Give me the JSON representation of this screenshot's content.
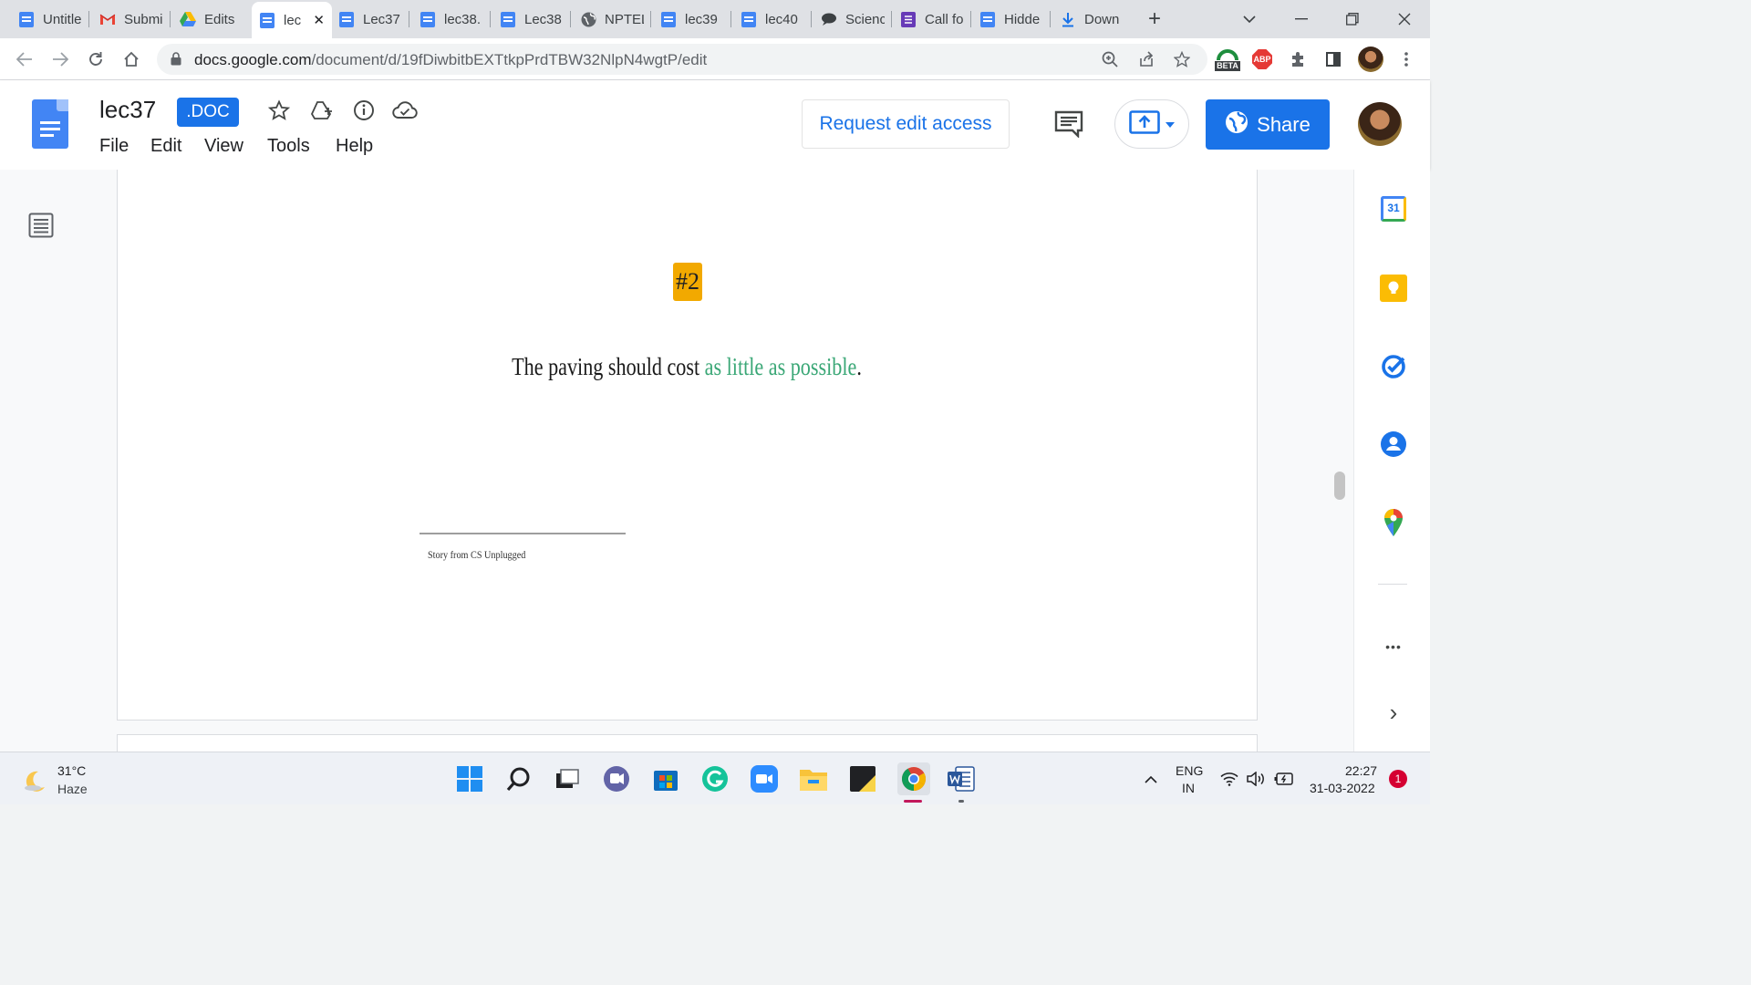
{
  "browser": {
    "tabs": [
      {
        "title": "Untitled",
        "icon": "docs-icon"
      },
      {
        "title": "Submi",
        "icon": "gmail-icon"
      },
      {
        "title": "Edits",
        "icon": "drive-icon"
      },
      {
        "title": "lec",
        "icon": "docs-icon"
      },
      {
        "title": "Lec37",
        "icon": "docs-icon"
      },
      {
        "title": "lec38.",
        "icon": "docs-icon"
      },
      {
        "title": "Lec38",
        "icon": "docs-icon"
      },
      {
        "title": "NPTEL",
        "icon": "globe-icon"
      },
      {
        "title": "lec39",
        "icon": "docs-icon"
      },
      {
        "title": "lec40",
        "icon": "docs-icon"
      },
      {
        "title": "Scienc",
        "icon": "chat-icon"
      },
      {
        "title": "Call fo",
        "icon": "forms-icon"
      },
      {
        "title": "Hidde",
        "icon": "docs-icon"
      },
      {
        "title": "Down",
        "icon": "download-icon"
      }
    ],
    "tab_close_glyph": "✕",
    "new_tab_glyph": "+",
    "url_host": "docs.google.com",
    "url_path": "/document/d/19fDiwbitbEXTtkpPrdTBW32NlpN4wgtP/edit",
    "beta_label": "BETA",
    "abp_label": "ABP"
  },
  "doc_header": {
    "title": "lec37",
    "badge": ".DOC",
    "menu": [
      "File",
      "Edit",
      "View",
      "Tools",
      "Help"
    ],
    "request_edit": "Request edit access",
    "share": "Share"
  },
  "document": {
    "tag": "#2",
    "sentence_prefix": "The paving should cost ",
    "sentence_highlight": "as little as possible",
    "sentence_suffix": ".",
    "footnote": "Story from CS Unplugged"
  },
  "side_panel": {
    "calendar_day": "31",
    "more_glyph": "•••",
    "expand_glyph": "›"
  },
  "taskbar": {
    "weather_temp": "31°C",
    "weather_desc": "Haze",
    "lang_top": "ENG",
    "lang_bottom": "IN",
    "time": "22:27",
    "date": "31-03-2022",
    "notification_count": "1"
  },
  "colors": {
    "accent": "#1a73e8",
    "tag_bg": "#f2a900",
    "highlight_text": "#3aa776"
  }
}
